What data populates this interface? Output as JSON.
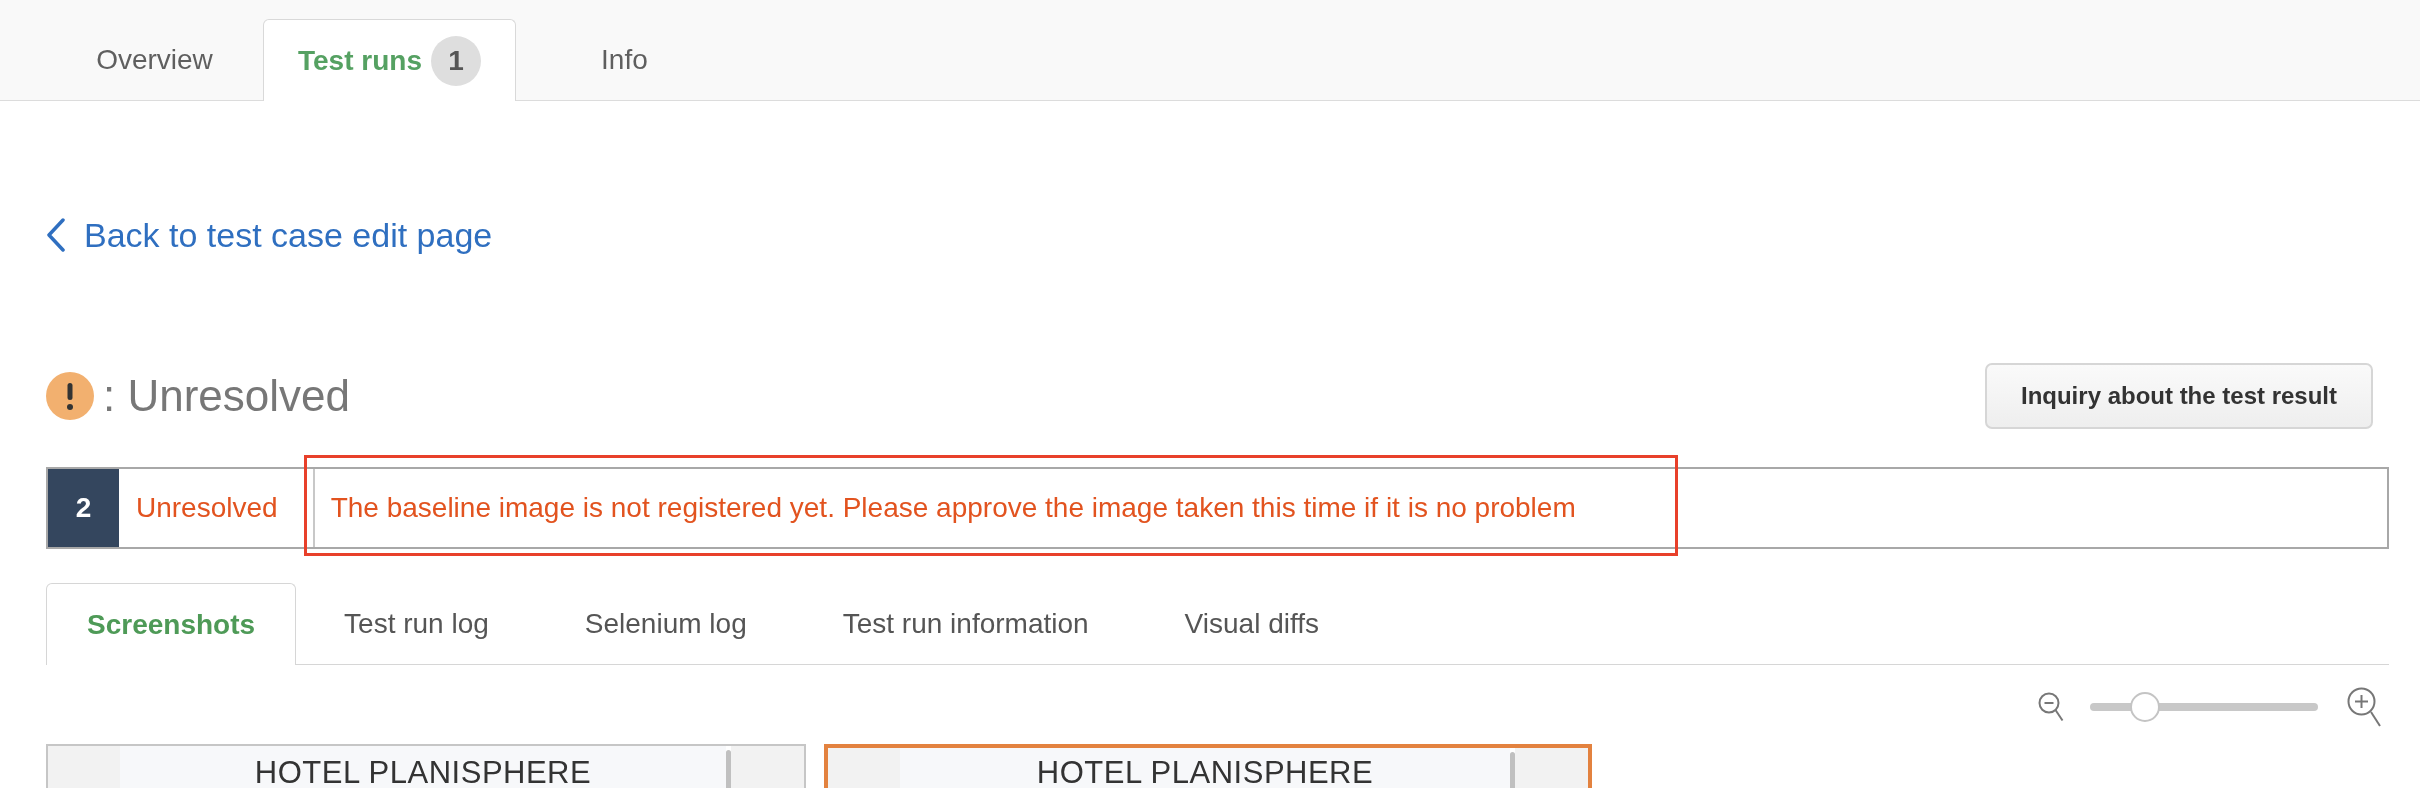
{
  "top_tabs": [
    {
      "label": "Overview",
      "selected": false
    },
    {
      "label": "Test runs",
      "selected": true,
      "badge": "1"
    },
    {
      "label": "Info",
      "selected": false
    }
  ],
  "back_link": "Back to test case edit page",
  "result": {
    "kind": "unresolved",
    "label": ": Unresolved"
  },
  "inquiry_button": "Inquiry about the test result",
  "status_row": {
    "number": "2",
    "status": "Unresolved",
    "message": "The baseline image is not registered yet. Please approve the image taken this time if it is no problem",
    "highlighted": true
  },
  "detail_tabs": [
    {
      "label": "Screenshots",
      "selected": true
    },
    {
      "label": "Test run log",
      "selected": false
    },
    {
      "label": "Selenium log",
      "selected": false
    },
    {
      "label": "Test run information",
      "selected": false
    },
    {
      "label": "Visual diffs",
      "selected": false
    }
  ],
  "zoom_slider": {
    "level": 0.2
  },
  "screenshots": [
    {
      "title": "HOTEL PLANISPHERE",
      "selected": false
    },
    {
      "title": "HOTEL PLANISPHERE",
      "selected": true
    }
  ]
}
